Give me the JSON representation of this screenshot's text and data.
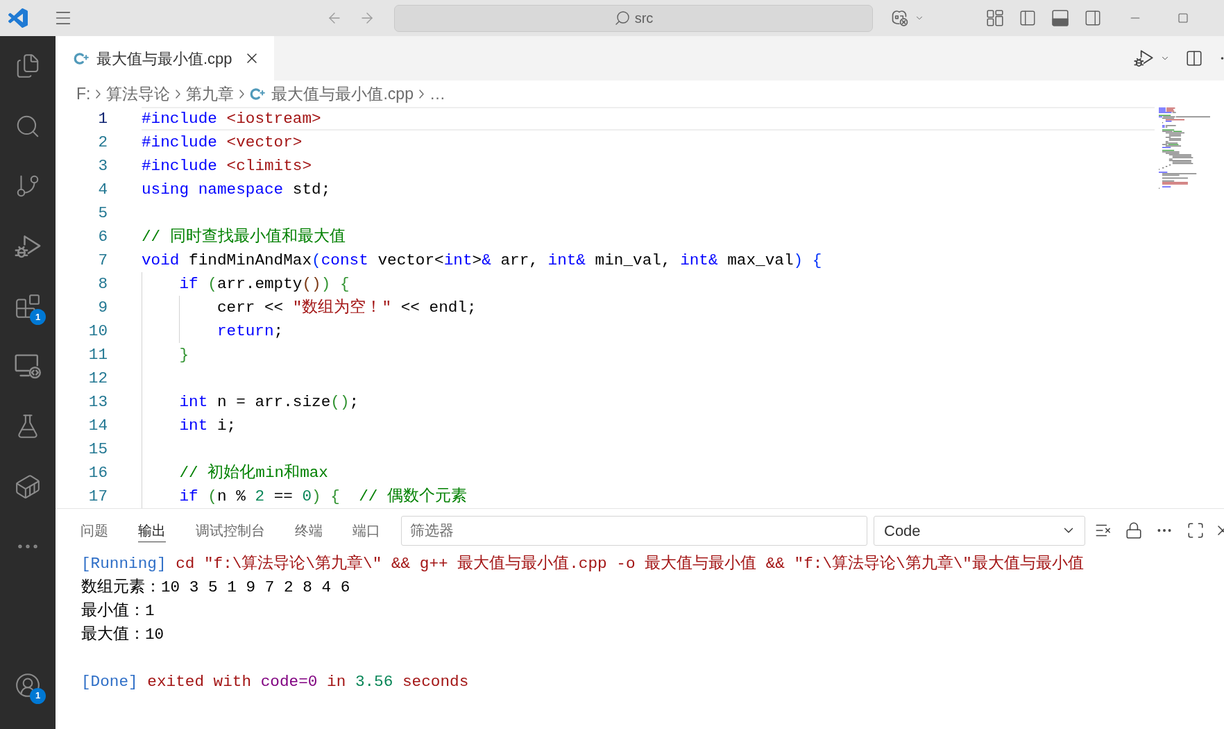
{
  "title_bar": {
    "command_center": {
      "label": "src"
    }
  },
  "activity_bar": {
    "items": [
      {
        "kind": "explorer"
      },
      {
        "kind": "search"
      },
      {
        "kind": "source_control"
      },
      {
        "kind": "run_debug"
      },
      {
        "kind": "extensions",
        "badge": "1"
      },
      {
        "kind": "remote_explorer"
      },
      {
        "kind": "testing"
      },
      {
        "kind": "containers"
      },
      {
        "kind": "more"
      }
    ],
    "bottom_items": [
      {
        "kind": "accounts",
        "badge": "1"
      }
    ]
  },
  "editor": {
    "tabs": [
      {
        "title": "最大值与最小值.cpp",
        "selected": true
      }
    ],
    "breadcrumb": [
      {
        "text": "F:",
        "kind": "path"
      },
      {
        "text": "算法导论",
        "kind": "path"
      },
      {
        "text": "第九章",
        "kind": "path"
      },
      {
        "text": "最大值与最小值.cpp",
        "kind": "file"
      },
      {
        "text": "…",
        "kind": "path"
      }
    ],
    "lines": [
      {
        "number": "1",
        "active": true,
        "tokens": [
          {
            "text": "#include",
            "kind": "keyword"
          },
          {
            "text": " <iostream>",
            "kind": "string"
          }
        ]
      },
      {
        "number": "2",
        "active": false,
        "tokens": [
          {
            "text": "#include",
            "kind": "keyword"
          },
          {
            "text": " <vector>",
            "kind": "string"
          }
        ]
      },
      {
        "number": "3",
        "active": false,
        "tokens": [
          {
            "text": "#include",
            "kind": "keyword"
          },
          {
            "text": " <climits>",
            "kind": "string"
          }
        ]
      },
      {
        "number": "4",
        "active": false,
        "tokens": [
          {
            "text": "using namespace",
            "kind": "keyword"
          },
          {
            "text": " std;",
            "kind": "plain"
          }
        ]
      },
      {
        "number": "5",
        "active": false
      },
      {
        "number": "6",
        "active": false,
        "tokens": [
          {
            "text": "// 同时查找最小值和最大值",
            "kind": "comment"
          }
        ]
      },
      {
        "number": "7",
        "active": false,
        "tokens": [
          {
            "text": "void",
            "kind": "keyword"
          },
          {
            "text": " findMinAndMax",
            "kind": "plain"
          },
          {
            "text": "(",
            "kind": "bracket1"
          },
          {
            "text": "const",
            "kind": "keyword"
          },
          {
            "text": " vector<",
            "kind": "plain"
          },
          {
            "text": "int",
            "kind": "keyword"
          },
          {
            "text": ">",
            "kind": "plain"
          },
          {
            "text": "&",
            "kind": "keyword"
          },
          {
            "text": " arr, ",
            "kind": "plain"
          },
          {
            "text": "int&",
            "kind": "keyword"
          },
          {
            "text": " min_val, ",
            "kind": "plain"
          },
          {
            "text": "int&",
            "kind": "keyword"
          },
          {
            "text": " max_val",
            "kind": "plain"
          },
          {
            "text": ") {",
            "kind": "bracket1"
          }
        ]
      },
      {
        "number": "8",
        "active": false,
        "tokens": [
          {
            "text": "    if",
            "kind": "keyword"
          },
          {
            "text": " (",
            "kind": "bracket2"
          },
          {
            "text": "arr.empty",
            "kind": "plain"
          },
          {
            "text": "()",
            "kind": "bracket3"
          },
          {
            "text": ") {",
            "kind": "bracket2"
          }
        ]
      },
      {
        "number": "9",
        "active": false,
        "tokens": [
          {
            "text": "        cerr << ",
            "kind": "plain"
          },
          {
            "text": "\"数组为空！\"",
            "kind": "string"
          },
          {
            "text": " << endl;",
            "kind": "plain"
          }
        ]
      },
      {
        "number": "10",
        "active": false,
        "tokens": [
          {
            "text": "        return",
            "kind": "keyword"
          },
          {
            "text": ";",
            "kind": "plain"
          }
        ]
      },
      {
        "number": "11",
        "active": false,
        "tokens": [
          {
            "text": "    }",
            "kind": "bracket2"
          }
        ]
      },
      {
        "number": "12",
        "active": false
      },
      {
        "number": "13",
        "active": false,
        "tokens": [
          {
            "text": "    int",
            "kind": "keyword"
          },
          {
            "text": " n = arr.size",
            "kind": "plain"
          },
          {
            "text": "()",
            "kind": "bracket2"
          },
          {
            "text": ";",
            "kind": "plain"
          }
        ]
      },
      {
        "number": "14",
        "active": false,
        "tokens": [
          {
            "text": "    int",
            "kind": "keyword"
          },
          {
            "text": " i;",
            "kind": "plain"
          }
        ]
      },
      {
        "number": "15",
        "active": false
      },
      {
        "number": "16",
        "active": false,
        "tokens": [
          {
            "text": "    // 初始化min和max",
            "kind": "comment"
          }
        ]
      },
      {
        "number": "17",
        "active": false,
        "tokens": [
          {
            "text": "    if",
            "kind": "keyword"
          },
          {
            "text": " (",
            "kind": "bracket2"
          },
          {
            "text": "n % ",
            "kind": "plain"
          },
          {
            "text": "2",
            "kind": "number"
          },
          {
            "text": " == ",
            "kind": "plain"
          },
          {
            "text": "0",
            "kind": "number"
          },
          {
            "text": ") {",
            "kind": "bracket2"
          },
          {
            "text": "  // 偶数个元素",
            "kind": "comment"
          }
        ]
      }
    ]
  },
  "panel": {
    "tabs": [
      {
        "label": "问题",
        "selected": false
      },
      {
        "label": "输出",
        "selected": true
      },
      {
        "label": "调试控制台",
        "selected": false
      },
      {
        "label": "终端",
        "selected": false
      },
      {
        "label": "端口",
        "selected": false
      }
    ],
    "filter": {
      "placeholder": "筛选器"
    },
    "channel": {
      "value": "Code"
    },
    "output": [
      {
        "kind": "text",
        "tokens": [
          {
            "text": "[Running]",
            "kind": "tag"
          },
          {
            "text": " cd \"f:\\算法导论\\第九章\\\" && g++ 最大值与最小值.cpp -o 最大值与最小值 && \"f:\\算法导论\\第九章\\\"最大值与最小值",
            "kind": "command"
          }
        ]
      },
      {
        "kind": "text",
        "tokens": [
          {
            "text": "数组元素：10 3 5 1 9 7 2 8 4 6",
            "kind": "plain"
          }
        ]
      },
      {
        "kind": "text",
        "tokens": [
          {
            "text": "最小值：1",
            "kind": "plain"
          }
        ]
      },
      {
        "kind": "text",
        "tokens": [
          {
            "text": "最大值：10",
            "kind": "plain"
          }
        ]
      },
      {
        "kind": "blank"
      },
      {
        "kind": "text",
        "tokens": [
          {
            "text": "[Done]",
            "kind": "tag"
          },
          {
            "text": " exited with ",
            "kind": "command"
          },
          {
            "text": "code=0",
            "kind": "code"
          },
          {
            "text": " in ",
            "kind": "command"
          },
          {
            "text": "3.56",
            "kind": "number"
          },
          {
            "text": " seconds",
            "kind": "command"
          }
        ]
      }
    ]
  }
}
